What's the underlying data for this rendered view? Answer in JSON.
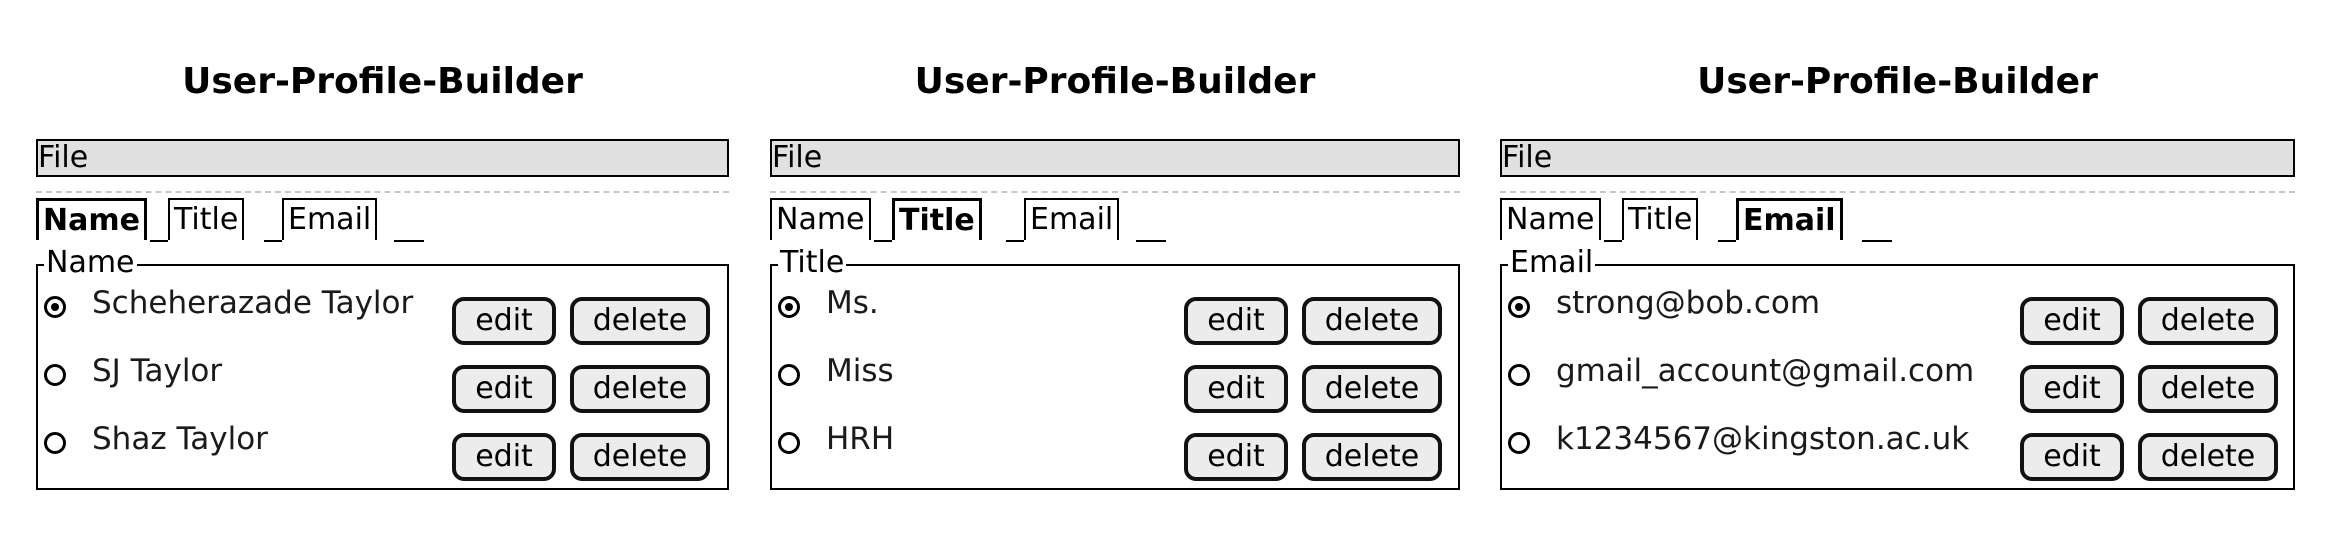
{
  "panels": [
    {
      "title": "User-Profile-Builder",
      "menu": [
        "File"
      ],
      "tabs": [
        {
          "label": "Name",
          "active": true
        },
        {
          "label": "Title",
          "active": false
        },
        {
          "label": "Email",
          "active": false
        }
      ],
      "group_legend": "Name",
      "rows": [
        {
          "label": "Scheherazade Taylor",
          "selected": true
        },
        {
          "label": "SJ Taylor",
          "selected": false
        },
        {
          "label": "Shaz Taylor",
          "selected": false
        }
      ],
      "edit_label": "edit",
      "delete_label": "delete"
    },
    {
      "title": "User-Profile-Builder",
      "menu": [
        "File"
      ],
      "tabs": [
        {
          "label": "Name",
          "active": false
        },
        {
          "label": "Title",
          "active": true
        },
        {
          "label": "Email",
          "active": false
        }
      ],
      "group_legend": "Title",
      "rows": [
        {
          "label": "Ms.",
          "selected": true
        },
        {
          "label": "Miss",
          "selected": false
        },
        {
          "label": "HRH",
          "selected": false
        }
      ],
      "edit_label": "edit",
      "delete_label": "delete"
    },
    {
      "title": "User-Profile-Builder",
      "menu": [
        "File"
      ],
      "tabs": [
        {
          "label": "Name",
          "active": false
        },
        {
          "label": "Title",
          "active": false
        },
        {
          "label": "Email",
          "active": true
        }
      ],
      "group_legend": "Email",
      "rows": [
        {
          "label": "strong@bob.com",
          "selected": true
        },
        {
          "label": "gmail_account@gmail.com",
          "selected": false
        },
        {
          "label": "k1234567@kingston.ac.uk",
          "selected": false
        }
      ],
      "edit_label": "edit",
      "delete_label": "delete"
    }
  ]
}
